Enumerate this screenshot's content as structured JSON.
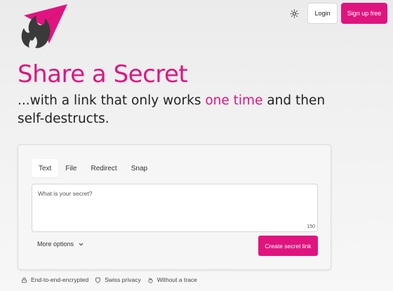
{
  "header": {
    "logo_icon": "flame-paper-plane-logo",
    "theme_icon": "sun-icon",
    "login_label": "Login",
    "signup_label": "Sign up free"
  },
  "hero": {
    "title": "Share a Secret",
    "subtitle_pre": "...with a link that only works ",
    "subtitle_accent": "one time",
    "subtitle_post": " and then self-destructs."
  },
  "form": {
    "tabs": [
      {
        "label": "Text",
        "active": true
      },
      {
        "label": "File",
        "active": false
      },
      {
        "label": "Redirect",
        "active": false
      },
      {
        "label": "Snap",
        "active": false
      }
    ],
    "secret_placeholder": "What is your secret?",
    "char_counter": "150",
    "more_options_label": "More options",
    "create_label": "Create secret link"
  },
  "features": [
    {
      "icon": "lock-icon",
      "label": "End-to-end-encrypted"
    },
    {
      "icon": "shield-icon",
      "label": "Swiss privacy"
    },
    {
      "icon": "flame-icon",
      "label": "Without a trace"
    }
  ],
  "colors": {
    "accent": "#e0147f",
    "logo_dark": "#3a3a3a"
  }
}
